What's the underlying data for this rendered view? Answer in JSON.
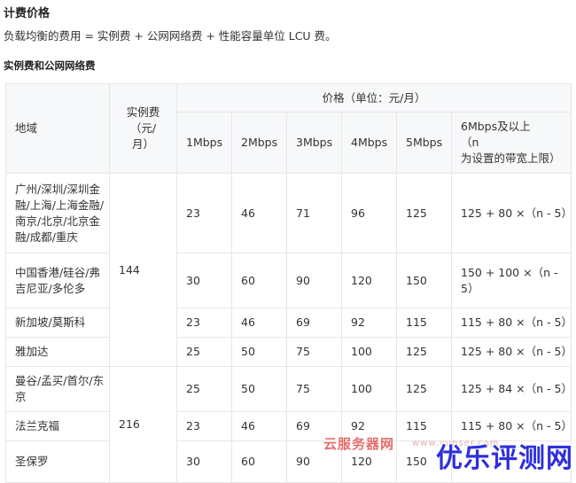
{
  "heading": "计费价格",
  "formula": "负载均衡的费用 = 实例费 + 公网网络费 + 性能容量单位 LCU 费。",
  "subheading": "实例费和公网网络费",
  "table": {
    "col_region": "地域",
    "col_instance": "实例费\n（元/\n月）",
    "col_price_group": "价格（单位：元/月）",
    "bandwidth_cols": [
      "1Mbps",
      "2Mbps",
      "3Mbps",
      "4Mbps",
      "5Mbps",
      "6Mbps及以上\n（n\n为设置的带宽上限）"
    ],
    "groups": [
      {
        "instance_fee": "144",
        "rows": [
          {
            "region": "广州/深圳/深圳金融/上海/上海金融/南京/北京/北京金融/成都/重庆",
            "prices": [
              "23",
              "46",
              "71",
              "96",
              "125",
              "125 + 80 ×（n - 5）"
            ]
          },
          {
            "region": "中国香港/硅谷/弗吉尼亚/多伦多",
            "prices": [
              "30",
              "60",
              "90",
              "120",
              "150",
              "150 + 100 ×（n - 5）"
            ]
          },
          {
            "region": "新加坡/莫斯科",
            "prices": [
              "23",
              "46",
              "69",
              "92",
              "115",
              "115 + 80 ×（n - 5）"
            ]
          },
          {
            "region": "雅加达",
            "prices": [
              "25",
              "50",
              "75",
              "100",
              "125",
              "125 + 80 ×（n - 5）"
            ]
          }
        ]
      },
      {
        "instance_fee": "216",
        "rows": [
          {
            "region": "曼谷/孟买/首尔/东京",
            "prices": [
              "25",
              "50",
              "75",
              "100",
              "125",
              "125 + 84 ×（n - 5）"
            ]
          },
          {
            "region": "法兰克福",
            "prices": [
              "23",
              "46",
              "69",
              "92",
              "115",
              "115 + 80 ×（n - 5）"
            ]
          },
          {
            "region": "圣保罗",
            "prices": [
              "30",
              "60",
              "90",
              "120",
              "150",
              ""
            ]
          }
        ]
      }
    ]
  },
  "watermark": {
    "site_name": "云服务器网",
    "site_url": "www.yunser.com",
    "brand": "优乐评测网"
  }
}
